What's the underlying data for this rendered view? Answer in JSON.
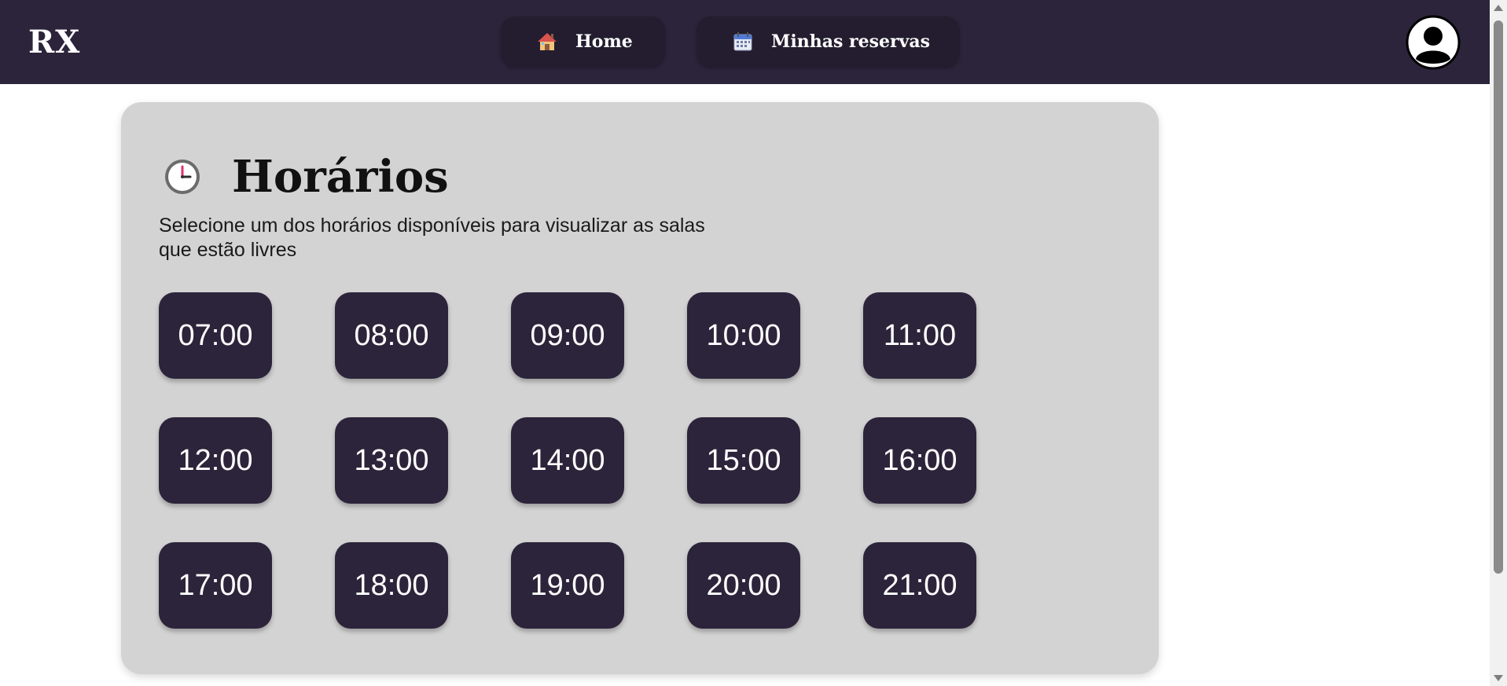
{
  "app": {
    "logo": "RX"
  },
  "nav": {
    "items": [
      {
        "label": "Home",
        "icon": "house-icon"
      },
      {
        "label": "Minhas reservas",
        "icon": "calendar-icon"
      }
    ]
  },
  "header": {
    "avatar_icon": "user-avatar-icon"
  },
  "main": {
    "title": "Horários",
    "title_icon": "clock-icon",
    "subtitle": "Selecione um dos horários disponíveis para visualizar as salas que estão livres",
    "time_slots": [
      "07:00",
      "08:00",
      "09:00",
      "10:00",
      "11:00",
      "12:00",
      "13:00",
      "14:00",
      "15:00",
      "16:00",
      "17:00",
      "18:00",
      "19:00",
      "20:00",
      "21:00"
    ]
  },
  "colors": {
    "navbar": "#2c243a",
    "nav_button": "#231d2f",
    "card": "#d3d3d3",
    "slot": "#2c243a"
  }
}
